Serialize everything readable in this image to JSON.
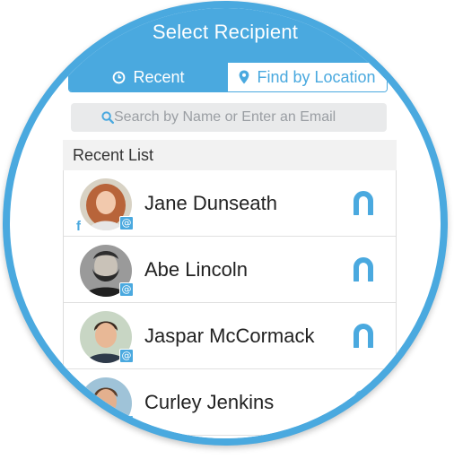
{
  "header": {
    "title": "Select Recipient"
  },
  "tabs": [
    {
      "label": "Recent",
      "icon": "clock-icon",
      "active": true
    },
    {
      "label": "Find by Location",
      "icon": "location-pin-icon",
      "active": false
    }
  ],
  "search": {
    "placeholder": "Search by Name or Enter an Email",
    "value": "",
    "icon": "search-icon"
  },
  "section": {
    "title": "Recent List"
  },
  "contacts": [
    {
      "name": "Jane Dunseath",
      "badge": "@",
      "facebook": "f"
    },
    {
      "name": "Abe Lincoln",
      "badge": "@"
    },
    {
      "name": "Jaspar McCormack",
      "badge": "@"
    },
    {
      "name": "Curley Jenkins",
      "badge": "@"
    }
  ],
  "colors": {
    "accent": "#4aa9df",
    "section_bg": "#f2f2f2",
    "search_bg": "#e9eaeb"
  }
}
